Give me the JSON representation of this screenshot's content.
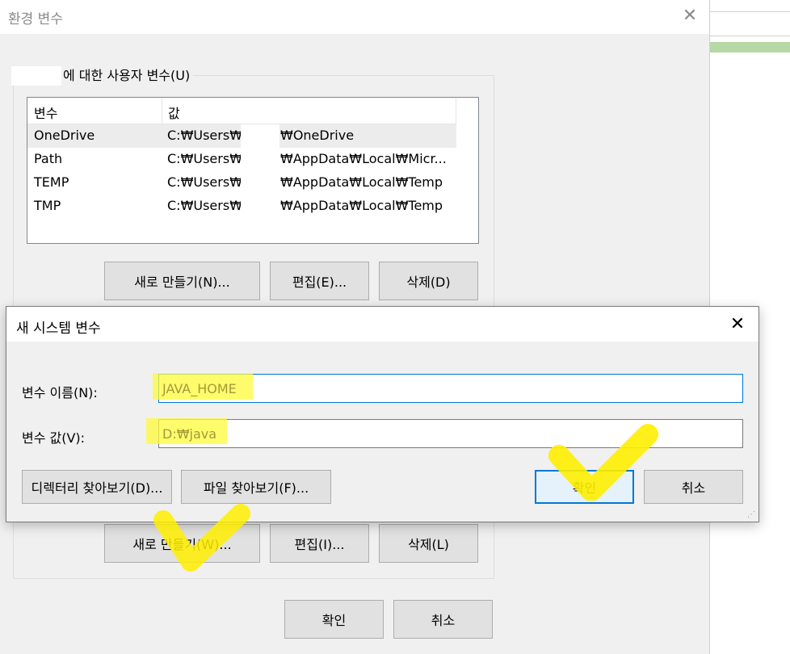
{
  "env_window": {
    "title": "환경 변수",
    "user_group_label": "에 대한 사용자 변수(U)",
    "columns": [
      "변수",
      "값"
    ],
    "rows": [
      {
        "name": "OneDrive",
        "value_prefix": "C:₩Users₩",
        "value_suffix": "₩OneDrive"
      },
      {
        "name": "Path",
        "value_prefix": "C:₩Users₩",
        "value_suffix": "₩AppData₩Local₩Micr..."
      },
      {
        "name": "TEMP",
        "value_prefix": "C:₩Users₩",
        "value_suffix": "₩AppData₩Local₩Temp"
      },
      {
        "name": "TMP",
        "value_prefix": "C:₩Users₩",
        "value_suffix": "₩AppData₩Local₩Temp"
      }
    ],
    "user_buttons": {
      "new": "새로 만들기(N)...",
      "edit": "편집(E)...",
      "delete": "삭제(D)"
    },
    "system_buttons": {
      "new": "새로 만들기(W)...",
      "edit": "편집(I)...",
      "delete": "삭제(L)"
    },
    "ok": "확인",
    "cancel": "취소"
  },
  "dialog": {
    "title": "새 시스템 변수",
    "name_label": "변수 이름(N):",
    "name_value": "JAVA_HOME",
    "value_label": "변수 값(V):",
    "value_value": "D:₩java",
    "browse_dir": "디렉터리 찾아보기(D)...",
    "browse_file": "파일 찾아보기(F)...",
    "ok": "확인",
    "cancel": "취소"
  },
  "icons": {
    "close": "close-icon",
    "grip": "resize-grip-icon",
    "check": "checkmark-annotation-icon"
  },
  "colors": {
    "highlight": "#fffb3b",
    "accent": "#0078d7",
    "annotation": "#ffee00"
  }
}
